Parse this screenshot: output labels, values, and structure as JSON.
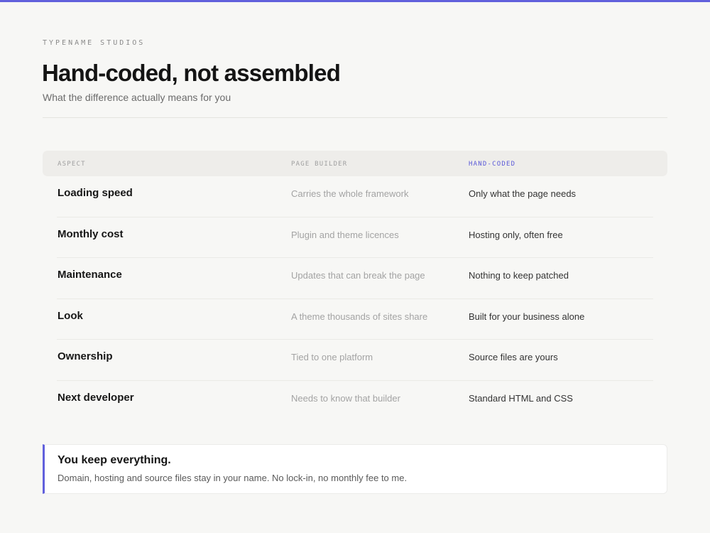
{
  "theme": {
    "accent": "#6160dc",
    "background": "#f7f7f5"
  },
  "header": {
    "brand": "TYPENAME STUDIOS",
    "title": "Hand-coded, not assembled",
    "subtitle": "What the difference actually means for you"
  },
  "table": {
    "columns": [
      "ASPECT",
      "PAGE BUILDER",
      "HAND-CODED"
    ],
    "rows": [
      {
        "aspect": "Loading speed",
        "builder": "Carries the whole framework",
        "hand": "Only what the page needs"
      },
      {
        "aspect": "Monthly cost",
        "builder": "Plugin and theme licences",
        "hand": "Hosting only, often free"
      },
      {
        "aspect": "Maintenance",
        "builder": "Updates that can break the page",
        "hand": "Nothing to keep patched"
      },
      {
        "aspect": "Look",
        "builder": "A theme thousands of sites share",
        "hand": "Built for your business alone"
      },
      {
        "aspect": "Ownership",
        "builder": "Tied to one platform",
        "hand": "Source files are yours"
      },
      {
        "aspect": "Next developer",
        "builder": "Needs to know that builder",
        "hand": "Standard HTML and CSS"
      }
    ]
  },
  "callout": {
    "title": "You keep everything.",
    "body": "Domain, hosting and source files stay in your name. No lock-in, no monthly fee to me."
  }
}
